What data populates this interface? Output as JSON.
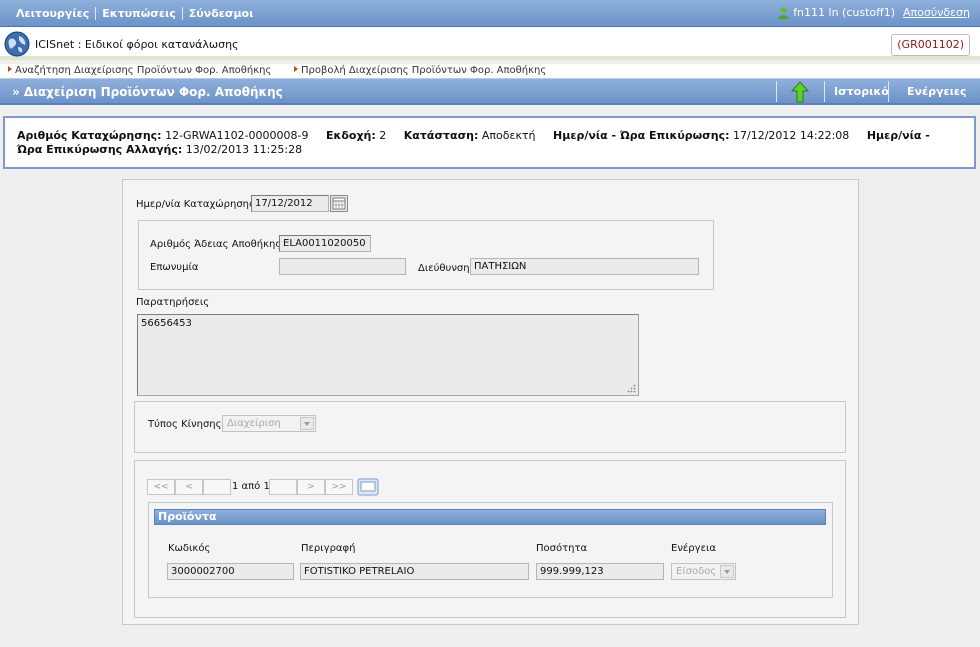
{
  "menu": [
    "Λειτουργίες",
    "Εκτυπώσεις",
    "Σύνδεσμοι"
  ],
  "user": {
    "name": "fn111 ln (custoff1)",
    "logout": "Αποσύνδεση"
  },
  "app": {
    "title": "ICISnet : Ειδικοί φόροι κατανάλωσης",
    "code": "(GR001102)"
  },
  "breadcrumbs": [
    "Αναζήτηση Διαχείρισης Προϊόντων Φορ. Αποθήκης",
    "Προβολή Διαχείρισης Προϊόντων Φορ. Αποθήκης"
  ],
  "titlebar": {
    "title": "» Διαχείριση Προϊόντων Φορ. Αποθήκης",
    "history": "Ιστορικό",
    "actions": "Ενέργειες"
  },
  "info": {
    "reg_label": "Αριθμός Καταχώρησης:",
    "reg_value": "12-GRWA1102-0000008-9",
    "version_label": "Εκδοχή:",
    "version_value": "2",
    "status_label": "Κατάσταση:",
    "status_value": "Αποδεκτή",
    "confirm_label": "Ημερ/νία - Ώρα Επικύρωσης:",
    "confirm_value": "17/12/2012 14:22:08",
    "change_label_1": "Ημερ/νία -",
    "change_label_2": "Ώρα Επικύρωσης Αλλαγής:",
    "change_value": "13/02/2013 11:25:28"
  },
  "form": {
    "reg_date_label": "Ημερ/νία Καταχώρησης",
    "reg_date": "17/12/2012",
    "license_label": "Αριθμός Άδειας Αποθήκης",
    "license": "ELA0011020050",
    "name_label": "Επωνυμία",
    "name": "",
    "address_label": "Διεύθυνση",
    "address": "ΠΑΤΗΣΙΩΝ",
    "remarks_label": "Παρατηρήσεις",
    "remarks": "56656453",
    "movement_label": "Τύπος Κίνησης",
    "movement": "Διαχείριση"
  },
  "pager": {
    "first": "<<",
    "prev": "<",
    "text": "1 από 1",
    "next": ">",
    "last": ">>"
  },
  "products": {
    "title": "Προϊόντα",
    "headers": [
      "Κωδικός",
      "Περιγραφή",
      "Ποσότητα",
      "Ενέργεια"
    ],
    "row": {
      "code": "3000002700",
      "description": "FOTISTIKO PETRELAIO",
      "quantity": "999.999,123",
      "action": "Είσοδος"
    }
  }
}
